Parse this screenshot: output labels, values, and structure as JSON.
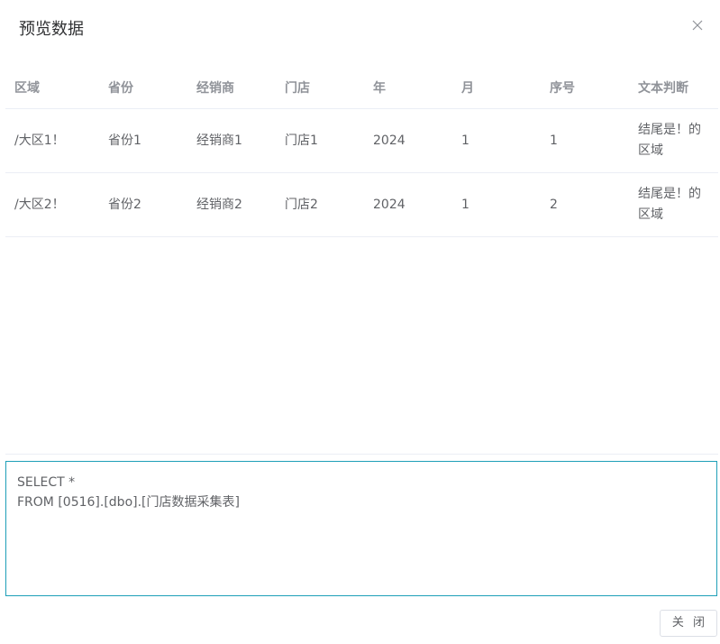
{
  "dialog": {
    "title": "预览数据",
    "close_label": "关 闭"
  },
  "table": {
    "columns": [
      "区域",
      "省份",
      "经销商",
      "门店",
      "年",
      "月",
      "序号",
      "文本判断"
    ],
    "rows": [
      [
        "/大区1！",
        "省份1",
        "经销商1",
        "门店1",
        "2024",
        "1",
        "1",
        "结尾是！的区域"
      ],
      [
        "/大区2！",
        "省份2",
        "经销商2",
        "门店2",
        "2024",
        "1",
        "2",
        "结尾是！的区域"
      ]
    ]
  },
  "sql": {
    "text": "SELECT *\nFROM [0516].[dbo].[门店数据采集表]"
  },
  "colors": {
    "sql_border": "#1e9fb8",
    "header_text": "#909399",
    "body_text": "#606266"
  }
}
